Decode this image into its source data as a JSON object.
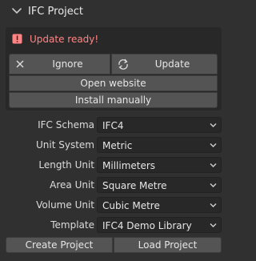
{
  "panel": {
    "title": "IFC Project"
  },
  "update": {
    "message": "Update ready!",
    "ignore_label": "Ignore",
    "update_label": "Update",
    "website_label": "Open website",
    "manual_label": "Install manually"
  },
  "fields": [
    {
      "label": "IFC Schema",
      "value": "IFC4"
    },
    {
      "label": "Unit System",
      "value": "Metric"
    },
    {
      "label": "Length Unit",
      "value": "Millimeters"
    },
    {
      "label": "Area Unit",
      "value": "Square Metre"
    },
    {
      "label": "Volume Unit",
      "value": "Cubic Metre"
    },
    {
      "label": "Template",
      "value": "IFC4 Demo Library"
    }
  ],
  "actions": {
    "create_label": "Create Project",
    "load_label": "Load Project"
  },
  "colors": {
    "background": "#303030",
    "box": "#282828",
    "button": "#545454",
    "warning": "#ff8585"
  },
  "icons": [
    "chevron-down-icon",
    "warning-icon",
    "close-icon",
    "refresh-icon",
    "dropdown-arrow-icon"
  ]
}
